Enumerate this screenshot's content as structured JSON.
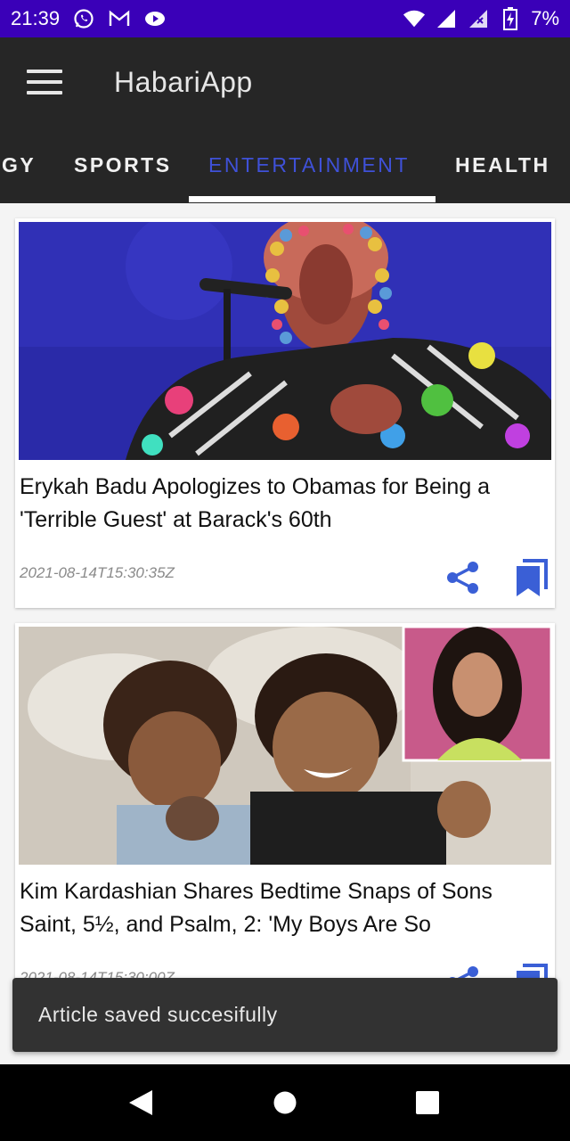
{
  "status_bar": {
    "time": "21:39",
    "battery": "7%",
    "icons": [
      "whatsapp-icon",
      "gmail-icon",
      "tv-icon",
      "wifi-icon",
      "signal-icon",
      "signal-x-icon",
      "battery-charging-icon"
    ]
  },
  "app_bar": {
    "title": "HabariApp",
    "menu_icon": "hamburger-menu-icon"
  },
  "tabs": [
    {
      "label": "GY"
    },
    {
      "label": "SPORTS"
    },
    {
      "label": "ENTERTAINMENT",
      "active": true
    },
    {
      "label": "HEALTH"
    }
  ],
  "colors": {
    "status_bar": "#3a00b8",
    "app_bar": "#262626",
    "tab_active": "#3f51d8",
    "action_icons": "#3a5fd6",
    "snackbar": "#323232"
  },
  "articles": [
    {
      "title": "Erykah Badu Apologizes to Obamas for Being a 'Terrible Guest' at Barack's 60th",
      "date": "2021-08-14T15:30:35Z",
      "image": "photo of singer with beaded headwrap at microphone"
    },
    {
      "title": "Kim Kardashian Shares Bedtime Snaps of Sons Saint, 5½, and Psalm, 2: 'My Boys Are So",
      "date": "2021-08-14T15:30:00Z",
      "image": "photo of two children in bed with inset portrait"
    }
  ],
  "snackbar": {
    "message": "Article saved succesifully"
  },
  "nav_bar": {
    "buttons": [
      "back-icon",
      "home-icon",
      "recents-icon"
    ]
  }
}
